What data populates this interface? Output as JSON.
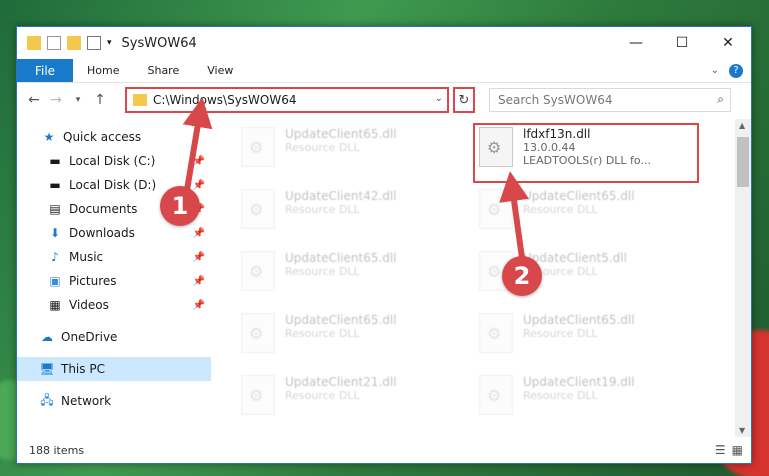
{
  "window": {
    "title": "SysWOW64"
  },
  "ribbon": {
    "file": "File",
    "tabs": [
      "Home",
      "Share",
      "View"
    ]
  },
  "address": {
    "path": "C:\\Windows\\SysWOW64"
  },
  "search": {
    "placeholder": "Search SysWOW64"
  },
  "sidebar": {
    "items": [
      {
        "label": "Quick access",
        "icon": "star-icon"
      },
      {
        "label": "Local Disk (C:)",
        "icon": "drive-icon"
      },
      {
        "label": "Local Disk (D:)",
        "icon": "drive-icon"
      },
      {
        "label": "Documents",
        "icon": "document-icon"
      },
      {
        "label": "Downloads",
        "icon": "download-icon"
      },
      {
        "label": "Music",
        "icon": "music-icon"
      },
      {
        "label": "Pictures",
        "icon": "pictures-icon"
      },
      {
        "label": "Videos",
        "icon": "video-icon"
      },
      {
        "label": "OneDrive",
        "icon": "cloud-icon"
      },
      {
        "label": "This PC",
        "icon": "computer-icon"
      },
      {
        "label": "Network",
        "icon": "network-icon"
      }
    ]
  },
  "files": [
    {
      "name": "UpdateClient65.dll",
      "sub": "Resource DLL"
    },
    {
      "name": "UpdateClient42.dll",
      "sub": "Resource DLL"
    },
    {
      "name": "UpdateClient65.dll",
      "sub": "Resource DLL"
    },
    {
      "name": "UpdateClient65.dll",
      "sub": "Resource DLL"
    },
    {
      "name": "UpdateClient21.dll",
      "sub": "Resource DLL"
    },
    {
      "name": "UpdateClient65.dll",
      "sub": "Resource DLL"
    },
    {
      "name": "UpdateClient5.dll",
      "sub": "Resource DLL"
    },
    {
      "name": "UpdateClient65.dll",
      "sub": "Resource DLL"
    },
    {
      "name": "UpdateClient19.dll",
      "sub": "Resource DLL"
    }
  ],
  "highlighted_file": {
    "name": "lfdxf13n.dll",
    "version": "13.0.0.44",
    "description": "LEADTOOLS(r) DLL fo..."
  },
  "status": {
    "items": "188 items"
  },
  "badges": {
    "one": "1",
    "two": "2"
  },
  "colors": {
    "accent": "#1979ca",
    "highlight": "#d8484b"
  }
}
